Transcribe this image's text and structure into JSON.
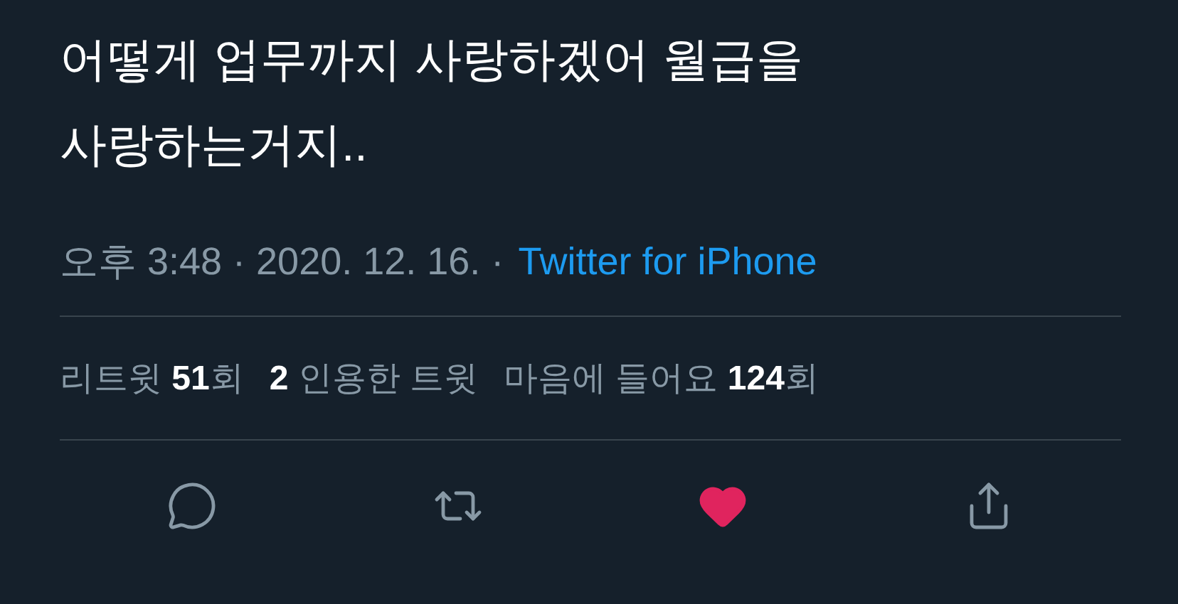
{
  "tweet": {
    "text": "어떻게 업무까지 사랑하겠어 월급을 사랑하는거지..",
    "meta": "오후 3:48 · 2020. 12. 16. ·",
    "source": "Twitter for iPhone",
    "stats": [
      "리트윗 **51**회",
      "**2** 인용한 트윗",
      "마음에 들어요 **124**회"
    ],
    "actions": [
      {
        "kind": "reply",
        "active": false
      },
      {
        "kind": "retweet",
        "active": false
      },
      {
        "kind": "like",
        "active": true
      },
      {
        "kind": "share",
        "active": false
      }
    ]
  }
}
